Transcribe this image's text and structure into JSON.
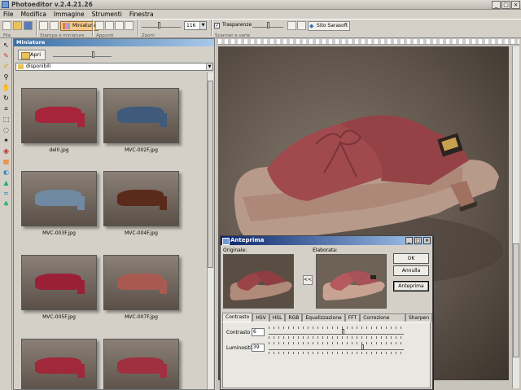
{
  "app": {
    "title": "Photoeditor v.2.4.21.26"
  },
  "menu": [
    "File",
    "Modifica",
    "Immagine",
    "Strumenti",
    "Finestra"
  ],
  "toolbar": {
    "groups": [
      "File",
      "Stampa e miniature",
      "Appunti",
      "Zoom",
      "Scanner e varie"
    ],
    "miniature_label": "Miniature",
    "zoom_value": "116",
    "zoom_level": 0.45,
    "transparency_label": "Trasparenze",
    "transparency_checked": true,
    "transparency_level": 0.5,
    "site_label": "Sito Sarasoft"
  },
  "left_panel": {
    "title": "Miniature",
    "open_label": "Apri",
    "thumb_size_level": 0.7,
    "folder": "disponibili",
    "thumbnails": [
      {
        "name": "del0.jpg",
        "color": "#a8243a"
      },
      {
        "name": "MVC-002F.jpg",
        "color": "#3f5a7a"
      },
      {
        "name": "MVC-003F.jpg",
        "color": "#6f8aa2"
      },
      {
        "name": "MVC-004F.jpg",
        "color": "#5a2a1a"
      },
      {
        "name": "MVC-005F.jpg",
        "color": "#9a2038"
      },
      {
        "name": "MVC-007F.jpg",
        "color": "#a85a50"
      },
      {
        "name": "",
        "color": "#a02838"
      },
      {
        "name": "",
        "color": "#a03040"
      }
    ]
  },
  "preview_dialog": {
    "title": "Anteprima",
    "original_label": "Originale:",
    "processed_label": "Elaborata:",
    "copy_button": "<<",
    "ok_label": "OK",
    "cancel_label": "Annulla",
    "preview_label": "Anteprima",
    "tabs": [
      "Contrasto",
      "HSV",
      "HSL",
      "RGB",
      "Equalizzazione",
      "FFT",
      "Correzione Gamma",
      "Sharpen"
    ],
    "active_tab": "Contrasto",
    "contrast_label": "Contrasto",
    "contrast_value": "6",
    "contrast_level": 0.55,
    "brightness_label": "Luminosità",
    "brightness_value": "39",
    "brightness_level": 0.7
  },
  "colors": {
    "shoe_main": "#a8525a",
    "shoe_sole": "#b07868",
    "accent": "#0a246a"
  }
}
